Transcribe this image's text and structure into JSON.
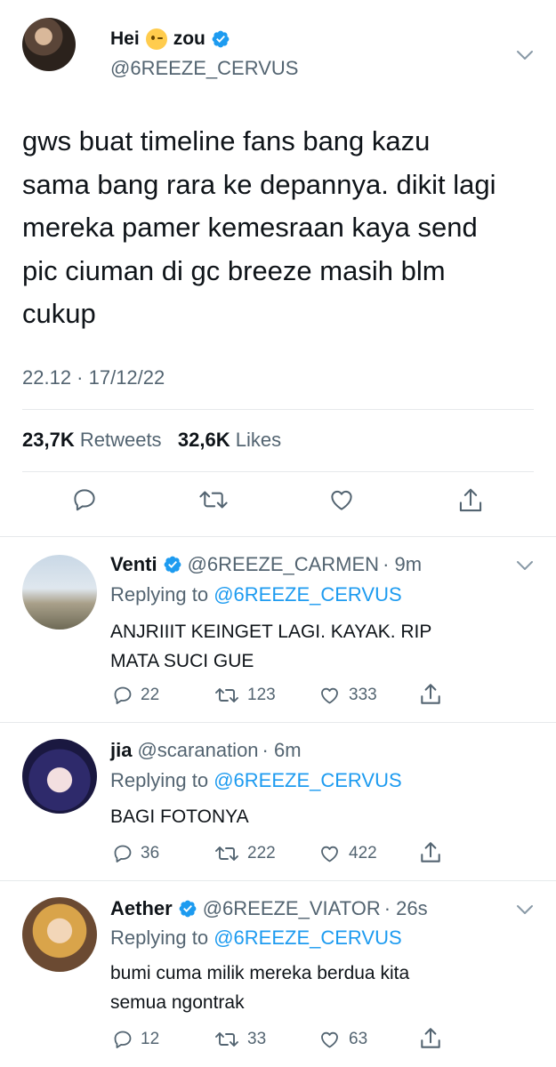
{
  "main_tweet": {
    "display_name_part1": "Hei",
    "display_name_part2": "zou",
    "handle": "@6REEZE_CERVUS",
    "text": "gws buat timeline fans bang kazu\nsama bang rara ke depannya. dikit lagi\nmereka pamer kemesraan kaya send\npic ciuman di gc breeze masih blm\ncukup",
    "timestamp": "22.12 · 17/12/22",
    "retweets_count": "23,7K",
    "retweets_label": "Retweets",
    "likes_count": "32,6K",
    "likes_label": "Likes"
  },
  "replies": [
    {
      "name": "Venti",
      "verified": true,
      "handle": "@6REEZE_CARMEN",
      "time": "· 9m",
      "replying_label": "Replying to",
      "replying_to": "@6REEZE_CERVUS",
      "text_line1": "ANJRIIIT KEINGET LAGI. KAYAK. RIP",
      "text_line2": "MATA SUCI GUE",
      "replies": "22",
      "retweets": "123",
      "likes": "333"
    },
    {
      "name": "jia",
      "verified": false,
      "handle": "@scaranation",
      "time": "· 6m",
      "replying_label": "Replying to",
      "replying_to": "@6REEZE_CERVUS",
      "text_line1": "BAGI FOTONYA",
      "text_line2": "",
      "replies": "36",
      "retweets": "222",
      "likes": "422"
    },
    {
      "name": "Aether",
      "verified": true,
      "handle": "@6REEZE_VIATOR",
      "time": "· 26s",
      "replying_label": "Replying to",
      "replying_to": "@6REEZE_CERVUS",
      "text_line1": "bumi cuma milik mereka berdua kita",
      "text_line2": "semua ngontrak",
      "replies": "12",
      "retweets": "33",
      "likes": "63"
    }
  ],
  "icons": {
    "verified": "verified-badge-icon",
    "reply": "speech-bubble-icon",
    "retweet": "retweet-arrows-icon",
    "like": "heart-icon",
    "share": "share-upload-icon",
    "more": "chevron-down-icon"
  },
  "colors": {
    "accent": "#1d9bf0",
    "secondary_text": "#536471",
    "primary_text": "#0f1419",
    "divider": "#e6e9eb"
  }
}
